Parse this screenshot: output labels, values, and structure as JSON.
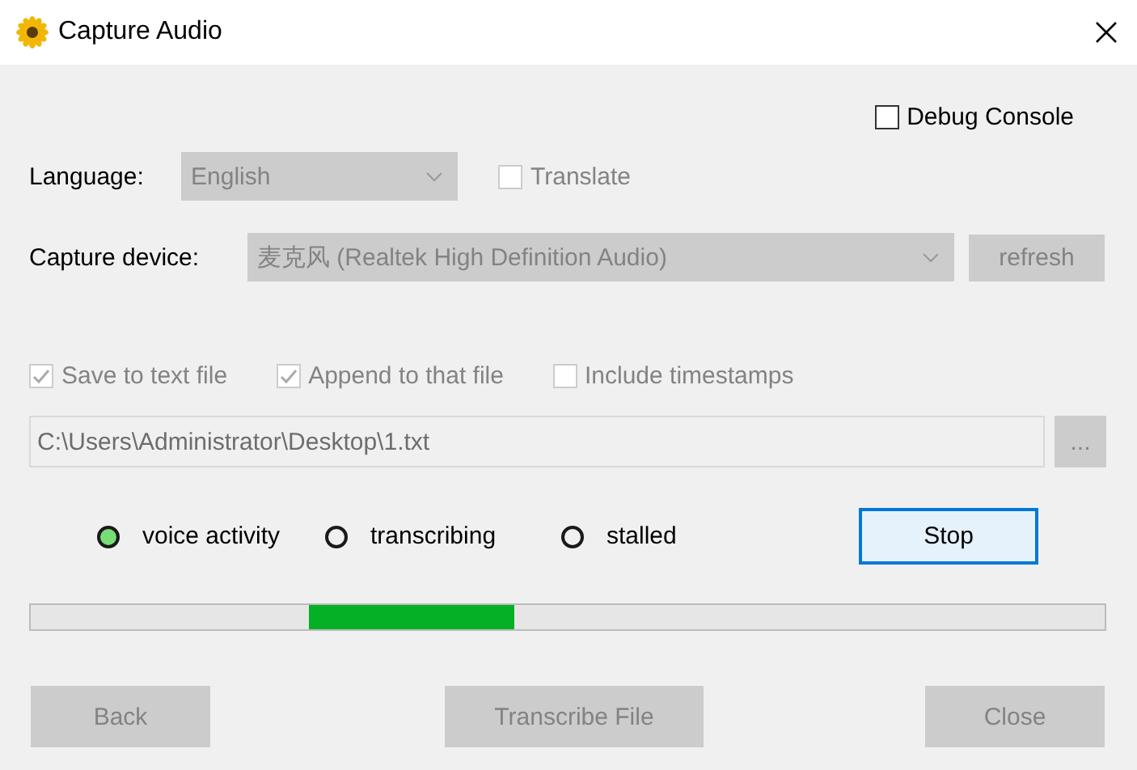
{
  "window": {
    "title": "Capture Audio"
  },
  "debug_console": {
    "label": "Debug Console",
    "checked": false,
    "disabled": false
  },
  "language": {
    "label": "Language:",
    "value": "English",
    "disabled": true
  },
  "translate": {
    "label": "Translate",
    "checked": false,
    "disabled": true
  },
  "capture_device": {
    "label": "Capture device:",
    "value": "麦克风 (Realtek High Definition Audio)",
    "disabled": true
  },
  "refresh_button": {
    "label": "refresh",
    "disabled": true
  },
  "options": [
    {
      "label": "Save to text file",
      "checked": true,
      "disabled": true
    },
    {
      "label": "Append to that file",
      "checked": true,
      "disabled": true
    },
    {
      "label": "Include timestamps",
      "checked": false,
      "disabled": true
    }
  ],
  "file_path": {
    "value": "C:\\Users\\Administrator\\Desktop\\1.txt",
    "disabled": true
  },
  "browse_button": {
    "label": "...",
    "disabled": true
  },
  "indicators": [
    {
      "label": "voice activity",
      "on": true
    },
    {
      "label": "transcribing",
      "on": false
    },
    {
      "label": "stalled",
      "on": false
    }
  ],
  "stop_button": {
    "label": "Stop",
    "disabled": false
  },
  "progress": {
    "kind": "marquee"
  },
  "buttons": [
    {
      "label": "Back",
      "disabled": true
    },
    {
      "label": "Transcribe File",
      "disabled": true
    },
    {
      "label": "Close",
      "disabled": true
    }
  ]
}
